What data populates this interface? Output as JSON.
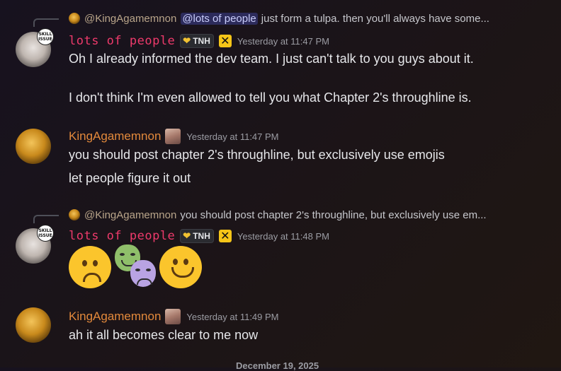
{
  "messages": [
    {
      "reply": {
        "author": "@KingAgamemnon",
        "mention": "@lots of people",
        "text": "just form a tulpa. then you'll always have some..."
      },
      "author": "lots of people",
      "guild_tag": "TNH",
      "timestamp": "Yesterday at 11:47 PM",
      "avatar_badge": "SKILL ISSUE",
      "lines": [
        "Oh I already informed the dev team. I just can't talk to you guys about it.",
        "I don't think I'm even allowed to tell you what Chapter 2's throughline is."
      ]
    },
    {
      "author": "KingAgamemnon",
      "timestamp": "Yesterday at 11:47 PM",
      "lines": [
        "you should post chapter 2's throughline, but exclusively use emojis",
        "let people figure it out"
      ]
    },
    {
      "reply": {
        "author": "@KingAgamemnon",
        "text": "you should post chapter 2's throughline, but exclusively use em..."
      },
      "author": "lots of people",
      "guild_tag": "TNH",
      "timestamp": "Yesterday at 11:48 PM",
      "avatar_badge": "SKILL ISSUE",
      "emojis": [
        "frowning-face",
        "performing-arts",
        "slightly-smiling-face"
      ]
    },
    {
      "author": "KingAgamemnon",
      "timestamp": "Yesterday at 11:49 PM",
      "lines": [
        "ah it all becomes clear to me now"
      ]
    }
  ],
  "date_divider": "December 19, 2025",
  "colors": {
    "pixel_name": "#ee3a6b",
    "king_name": "#e3893b",
    "mention_bg": "#5865f2",
    "badge_gold": "#f5c518"
  }
}
